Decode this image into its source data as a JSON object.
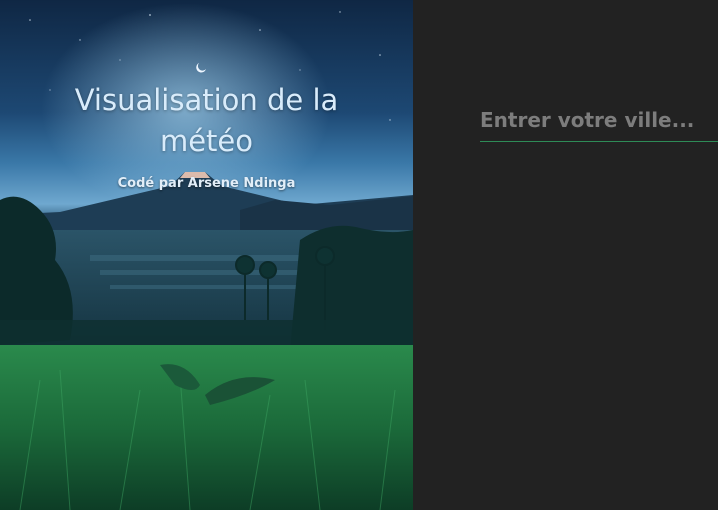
{
  "hero": {
    "title": "Visualisation de la météo",
    "subtitle": "Codé par Arsene Ndinga",
    "background_image": "night-mountain-valley-grass"
  },
  "search": {
    "placeholder": "Entrer votre ville...",
    "value": ""
  },
  "colors": {
    "panel_background": "#222222",
    "input_underline": "#2e8b57",
    "placeholder_text": "#7d7d7d",
    "hero_title": "#d9ecfb"
  }
}
